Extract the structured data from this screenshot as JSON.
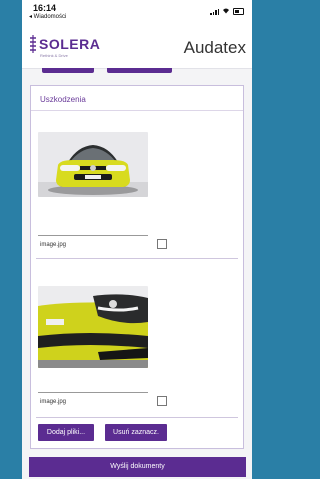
{
  "status_bar": {
    "time": "16:14",
    "back_label": "◂ Wiadomości"
  },
  "header": {
    "logo_text": "SOLERA",
    "logo_sub": "Rethink & Drive",
    "brand": "Audatex"
  },
  "section": {
    "title": "Uszkodzenia"
  },
  "files": [
    {
      "name": "image.jpg",
      "checked": false
    },
    {
      "name": "image.jpg",
      "checked": false
    }
  ],
  "buttons": {
    "add_files": "Dodaj pliki...",
    "remove_selected": "Usuń zaznacz."
  },
  "send_button": "Wyślij dokumenty",
  "colors": {
    "accent": "#5b2c91",
    "background": "#2a7fa6"
  }
}
